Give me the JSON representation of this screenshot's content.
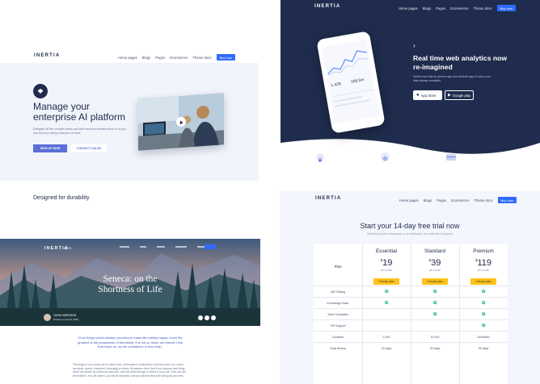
{
  "panel1": {
    "logo": "INERTIA",
    "nav": [
      "Home pages",
      "Blogs",
      "Pages",
      "Ecommerce",
      "Theme docs"
    ],
    "buy": "Buy now",
    "title_line1": "Manage your",
    "title_line2": "enterprise AI platform",
    "desc": "Delegate all the complex tasks and web services infrastructure to us you can focus on doing what you do best",
    "btn_primary": "SIGN UP NOW",
    "btn_secondary": "CONTACT SALES",
    "section_heading": "Designed for durability"
  },
  "panel2": {
    "logo": "INERTIA",
    "nav": [
      "Home pages",
      "Blogs",
      "Pages",
      "Ecommerce",
      "Theme docs"
    ],
    "buy": "Buy now",
    "title_line1": "Real time web analytics now",
    "title_line2": "re-imagined",
    "desc": "Inertia has built an iphone app and android app to have your data always available.",
    "appstore": "App Store",
    "googleplay": "Google play",
    "phone_stat1": "1,428",
    "phone_stat2": "158.5m",
    "colors": {
      "bg": "#1f2c4d",
      "accent": "#2f6bff"
    }
  },
  "panel3": {
    "logo": "INERTIA",
    "logo_sub": "BLOG",
    "title_line1": "Seneca: on the",
    "title_line2": "Shortness of Life",
    "author_name": "JOHN HARRISON",
    "author_date": "Posted on April 8, 2020",
    "quote": "Of all things which wisdom provides to make life entirely happy, much the greatest is the possession of friendship. It is not so much our friends' help that helps us, as the confidence of their help.",
    "body": "The things in our control are by nature free, unrestrained, unhindered; but those not in our control are weak, slavish, restrained, belonging to others. Remember, then, that if you suppose that things which are slavish by nature are also free, and that what belongs to others is your own, then you will be hindered. You will lament, you will be disturbed, and you will find fault both with gods and men."
  },
  "panel4": {
    "logo": "INERTIA",
    "nav": [
      "Home pages",
      "Blogs",
      "Pages",
      "Ecommerce",
      "Theme docs"
    ],
    "buy": "Buy now",
    "title": "Start your 14-day free trial now",
    "subtitle": "Whether you're a business or an individual, no credit card required",
    "plan_label": "Plan",
    "plans": [
      {
        "name": "Essential",
        "price": "19",
        "per": "per month",
        "btn": "Choose plan"
      },
      {
        "name": "Standard",
        "price": "39",
        "per": "per month",
        "btn": "Choose plan"
      },
      {
        "name": "Premium",
        "price": "119",
        "per": "per month",
        "btn": "Choose plan"
      }
    ],
    "currency": "$",
    "features": [
      {
        "label": "A/B Testing",
        "values": [
          "check",
          "check",
          "check"
        ]
      },
      {
        "label": "Knowledge Base",
        "values": [
          "check",
          "check",
          "check"
        ]
      },
      {
        "label": "Team Templates",
        "values": [
          "",
          "check",
          "check"
        ]
      },
      {
        "label": "VIP Support",
        "values": [
          "",
          "",
          "check"
        ]
      },
      {
        "label": "Contacts",
        "values": [
          "2,000",
          "10,000",
          "Unlimited"
        ]
      },
      {
        "label": "Data History",
        "values": [
          "15 days",
          "30 days",
          "90 days"
        ]
      }
    ]
  }
}
